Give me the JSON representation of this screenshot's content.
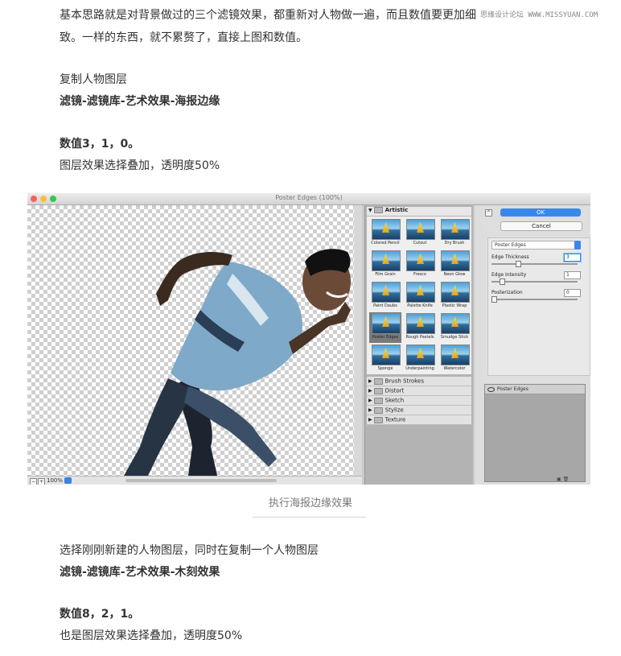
{
  "article": {
    "p1_line1": "基本思路就是对背景做过的三个滤镜效果，都重新对人物做一遍，而且数值要更加细",
    "p1_line2": "致。一样的东西，就不累赘了，直接上图和数值。",
    "step1_title": "复制人物图层",
    "step1_menu": "滤镜-滤镜库-艺术效果-海报边缘",
    "step1_values": "数值3，1，0。",
    "step1_note": "图层效果选择叠加，透明度50%",
    "caption": "执行海报边缘效果",
    "step2_title": "选择刚刚新建的人物图层，同时在复制一个人物图层",
    "step2_menu": "滤镜-滤镜库-艺术效果-木刻效果",
    "step2_values": "数值8，2，1。",
    "step2_note": "也是图层效果选择叠加，透明度50%"
  },
  "watermark": "思缘设计论坛 WWW.MISSYUAN.COM",
  "screenshot": {
    "window_title": "Poster Edges (100%)",
    "zoom": "100%",
    "gallery": {
      "category": "Artistic",
      "filters": [
        "Colored Pencil",
        "Cutout",
        "Dry Brush",
        "Film Grain",
        "Fresco",
        "Neon Glow",
        "Paint Daubs",
        "Palette Knife",
        "Plastic Wrap",
        "Poster Edges",
        "Rough Pastels",
        "Smudge Stick",
        "Sponge",
        "Underpainting",
        "Watercolor"
      ],
      "selected_filter": "Poster Edges",
      "other_categories": [
        "Brush Strokes",
        "Distort",
        "Sketch",
        "Stylize",
        "Texture"
      ]
    },
    "panel": {
      "ok_label": "OK",
      "cancel_label": "Cancel",
      "filter_select": "Poster Edges",
      "params": [
        {
          "label": "Edge Thickness",
          "value": "3"
        },
        {
          "label": "Edge Intensity",
          "value": "1"
        },
        {
          "label": "Posterization",
          "value": "0"
        }
      ],
      "param_levels": [
        0.3,
        0.1,
        0.0
      ],
      "layer_name": "Poster Edges"
    },
    "colors": {
      "accent_blue": "#3a87ea",
      "close_red": "#fc605c",
      "min_yellow": "#fdbc40",
      "max_green": "#34c84a"
    }
  }
}
